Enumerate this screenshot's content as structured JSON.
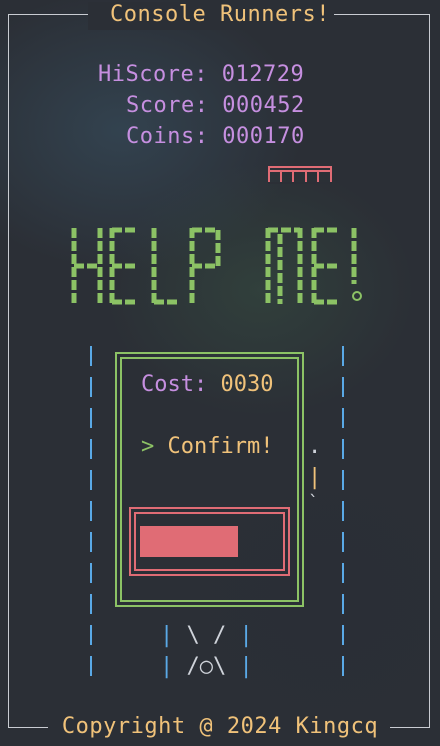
{
  "header": {
    "title": "Console Runners!"
  },
  "stats": {
    "hiscore_label": "HiScore:",
    "hiscore_value": "012729",
    "score_label": "Score:",
    "score_value": "000452",
    "coins_label": "Coins:",
    "coins_value": "000170"
  },
  "banner": {
    "text": "HELP ME!"
  },
  "dialog": {
    "cost_label": "Cost:",
    "cost_value": "0030",
    "confirm_caret": ">",
    "confirm_label": "Confirm!",
    "progress_fraction": 0.71
  },
  "footer": {
    "copyright": "Copyright @ 2024 Kingcq"
  },
  "colors": {
    "accent_yellow": "#f0c27a",
    "stat_purple": "#c68fe0",
    "banner_green": "#8cc265",
    "rail_blue": "#5aa9e6",
    "alert_red": "#e06c75"
  },
  "icons": {
    "coin_stack": "coin-stack-icon",
    "player": "runner-player-icon"
  }
}
